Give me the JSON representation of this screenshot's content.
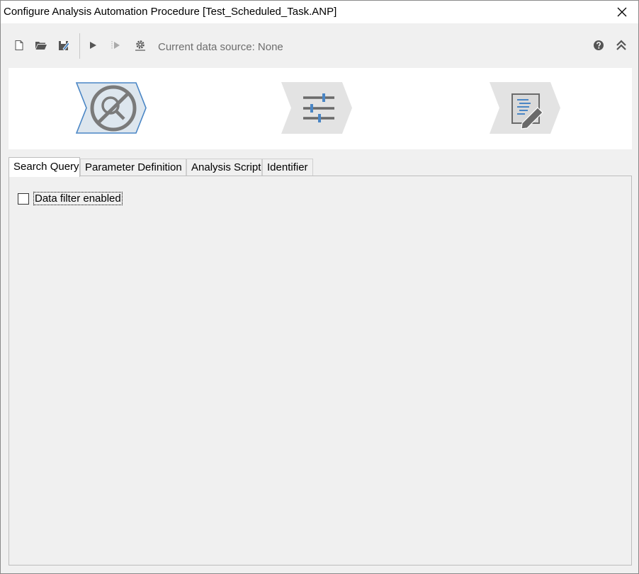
{
  "window": {
    "title": "Configure Analysis Automation Procedure [Test_Scheduled_Task.ANP]"
  },
  "toolbar": {
    "buttons": [
      {
        "name": "new",
        "icon": "new-file-icon"
      },
      {
        "name": "open",
        "icon": "open-folder-icon"
      },
      {
        "name": "save",
        "icon": "save-icon"
      },
      {
        "name": "run",
        "icon": "play-icon"
      },
      {
        "name": "step",
        "icon": "step-run-icon"
      },
      {
        "name": "settings",
        "icon": "gear-icon"
      }
    ],
    "data_source_label": "Current data source: None",
    "right_buttons": [
      {
        "name": "help",
        "icon": "help-icon"
      },
      {
        "name": "collapse",
        "icon": "collapse-up-icon"
      }
    ]
  },
  "wizard": {
    "steps": [
      {
        "name": "search-query",
        "icon": "no-search-icon",
        "active": true
      },
      {
        "name": "parameters",
        "icon": "sliders-icon",
        "active": false
      },
      {
        "name": "script",
        "icon": "script-edit-icon",
        "active": false
      }
    ],
    "colors": {
      "active_fill": "#dde6ee",
      "active_border": "#4a86c5",
      "inactive_fill": "#e3e3e3"
    }
  },
  "tabs": [
    {
      "label": "Search Query",
      "active": true
    },
    {
      "label": "Parameter Definition",
      "active": false
    },
    {
      "label": "Analysis Script",
      "active": false
    },
    {
      "label": "Identifier",
      "active": false
    }
  ],
  "search_query": {
    "data_filter_label": "Data filter enabled",
    "data_filter_checked": false
  }
}
